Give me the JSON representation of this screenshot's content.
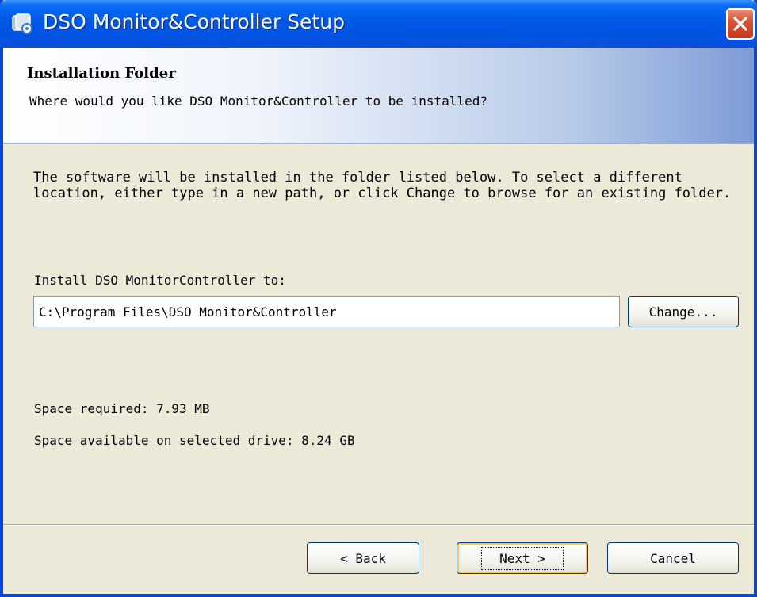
{
  "window": {
    "title": "DSO Monitor&Controller Setup"
  },
  "header": {
    "title": "Installation Folder",
    "subtitle": "Where would you like DSO Monitor&Controller to be installed?"
  },
  "content": {
    "description": "The software will be installed in the folder listed below. To select a different location, either type in a new path, or click Change to browse for an existing folder.",
    "install_label": "Install DSO MonitorController to:",
    "install_path": "C:\\Program Files\\DSO Monitor&Controller",
    "change_label": "Change...",
    "space_required": "Space required: 7.93 MB",
    "space_available": "Space available on selected drive: 8.24 GB"
  },
  "footer": {
    "back_label": "< Back",
    "next_label": "Next >",
    "cancel_label": "Cancel"
  },
  "colors": {
    "titlebar": "#0054e3",
    "close_button": "#d8553a",
    "dialog_bg": "#ece9d8",
    "button_border": "#003c74"
  },
  "icons": {
    "app": "installer-app-icon",
    "close": "close-icon"
  }
}
